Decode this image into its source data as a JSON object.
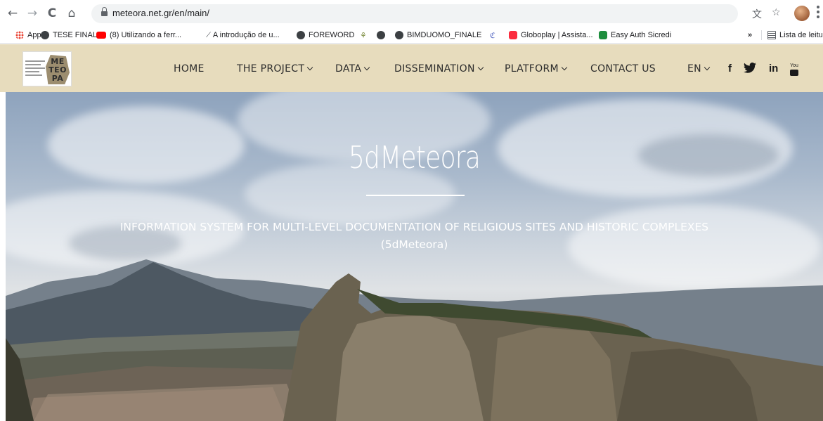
{
  "browser": {
    "url": "meteora.net.gr/en/main/",
    "nav_icons": [
      "back-icon",
      "forward-icon",
      "reload-icon",
      "home-icon"
    ],
    "right_icons": [
      "translate-icon",
      "star-icon",
      "profile-avatar",
      "menu-icon"
    ]
  },
  "bookmarks": {
    "items": [
      {
        "label": "Apps",
        "icon": "apps-grid-icon"
      },
      {
        "label": "TESE FINAL",
        "icon": "globe-icon"
      },
      {
        "label": "(8) Utilizando a ferr...",
        "icon": "youtube-icon"
      },
      {
        "label": "A introdução de u...",
        "icon": "site-icon"
      },
      {
        "label": "FOREWORD",
        "icon": "globe-icon"
      },
      {
        "label": "",
        "icon": "site-icon"
      },
      {
        "label": "",
        "icon": "globe-icon"
      },
      {
        "label": "BIMDUOMO_FINALE",
        "icon": "globe-icon"
      },
      {
        "label": "",
        "icon": "site-icon"
      },
      {
        "label": "Globoplay | Assista...",
        "icon": "globoplay-icon"
      },
      {
        "label": "Easy Auth Sicredi",
        "icon": "lock-icon"
      }
    ],
    "overflow": "»",
    "reading_list": "Lista de leitur"
  },
  "site": {
    "logo_text": "ME TEO PA",
    "menu": [
      {
        "label": "HOME",
        "dropdown": false
      },
      {
        "label": "THE PROJECT",
        "dropdown": true
      },
      {
        "label": "DATA",
        "dropdown": true
      },
      {
        "label": "DISSEMINATION",
        "dropdown": true
      },
      {
        "label": "PLATFORM",
        "dropdown": true
      },
      {
        "label": "CONTACT US",
        "dropdown": false
      }
    ],
    "language": "EN",
    "social": {
      "facebook": "f",
      "twitter": "🐦",
      "linkedin": "in",
      "youtube": "▶"
    }
  },
  "hero": {
    "title": "5dMeteora",
    "subtitle": "INFORMATION SYSTEM FOR MULTI-LEVEL DOCUMENTATION OF RELIGIOUS SITES AND HISTORIC COMPLEXES (5dMeteora)"
  },
  "colors": {
    "header_bg": "#e7dcbd",
    "accent_white": "#ffffff"
  }
}
